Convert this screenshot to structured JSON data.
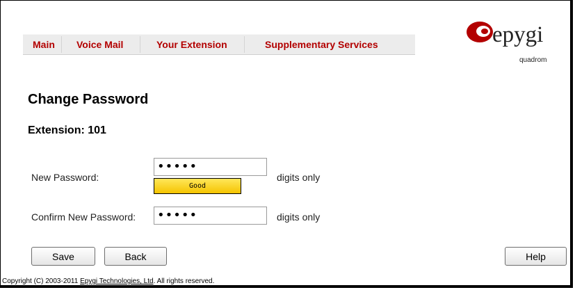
{
  "nav": {
    "items": [
      {
        "label": "Main"
      },
      {
        "label": "Voice Mail"
      },
      {
        "label": "Your Extension"
      },
      {
        "label": "Supplementary Services"
      }
    ]
  },
  "logo": {
    "brand": "epygi",
    "product": "quadrom",
    "icon": "epygi-logo-icon",
    "color": "#b30000"
  },
  "page": {
    "title": "Change Password",
    "extension": "Extension: 101"
  },
  "form": {
    "new_password": {
      "label": "New Password:",
      "value": "•••••",
      "hint": "digits only"
    },
    "strength": {
      "label": "Good"
    },
    "confirm_password": {
      "label": "Confirm New Password:",
      "value": "•••••",
      "hint": "digits only"
    }
  },
  "buttons": {
    "save": "Save",
    "back": "Back",
    "help": "Help"
  },
  "footer": {
    "prefix": "Copyright (C) 2003-2011 ",
    "company": "Epygi Technologies, Ltd",
    "suffix": ". All rights reserved."
  }
}
